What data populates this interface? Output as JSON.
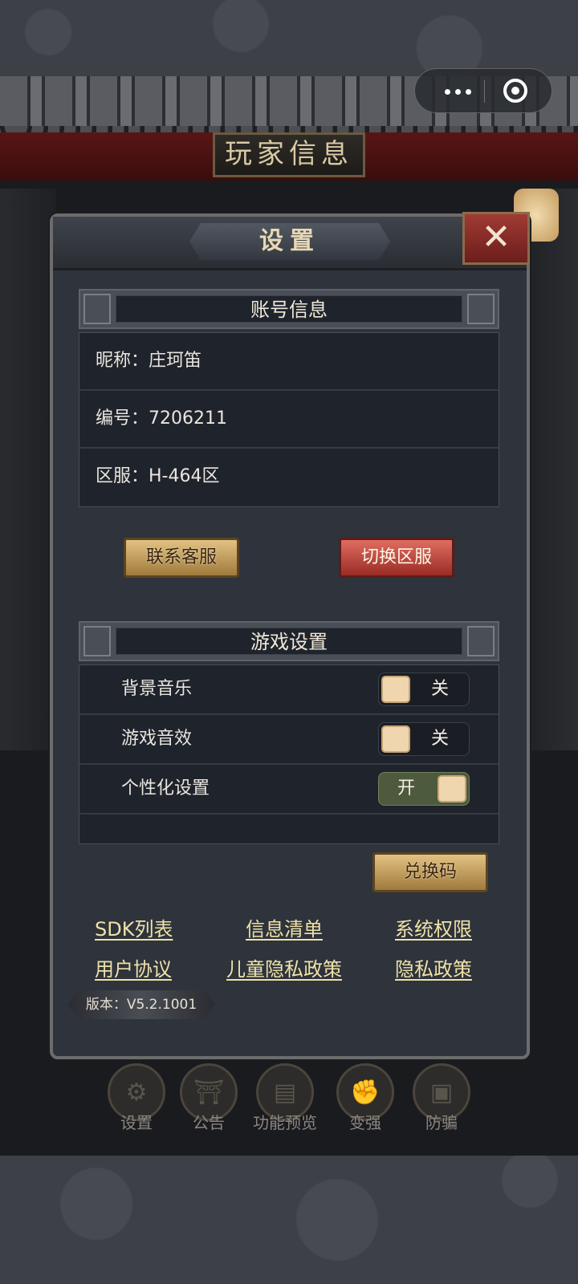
{
  "system": {
    "more_icon": "more-dots-icon",
    "target_icon": "target-icon"
  },
  "game": {
    "header_title": "玩家信息",
    "bottom_nav": [
      {
        "label": "设置",
        "icon": "gear-icon"
      },
      {
        "label": "公告",
        "icon": "notice-icon"
      },
      {
        "label": "功能预览",
        "icon": "book-icon"
      },
      {
        "label": "变强",
        "icon": "strength-icon"
      },
      {
        "label": "防骗",
        "icon": "shield-icon"
      }
    ]
  },
  "modal": {
    "title": "设置",
    "close_icon": "close-icon",
    "account_section": {
      "title": "账号信息",
      "rows": [
        "昵称：庄珂笛",
        "编号：7206211",
        "区服：H-464区"
      ]
    },
    "buttons": {
      "contact": "联系客服",
      "switch_server": "切换区服",
      "redeem": "兑换码"
    },
    "game_settings": {
      "title": "游戏设置",
      "rows": [
        {
          "label": "背景音乐",
          "state": "关"
        },
        {
          "label": "游戏音效",
          "state": "关"
        },
        {
          "label": "个性化设置",
          "state": "开"
        }
      ]
    },
    "links": {
      "sdk": "SDK列表",
      "info": "信息清单",
      "permission": "系统权限",
      "user_agreement": "用户协议",
      "child_privacy": "儿童隐私政策",
      "privacy": "隐私政策"
    },
    "version": "版本：V5.2.1001"
  },
  "colors": {
    "accent_gold": "#e2c282",
    "accent_red": "#9a2c26",
    "link": "#eee2a8"
  }
}
